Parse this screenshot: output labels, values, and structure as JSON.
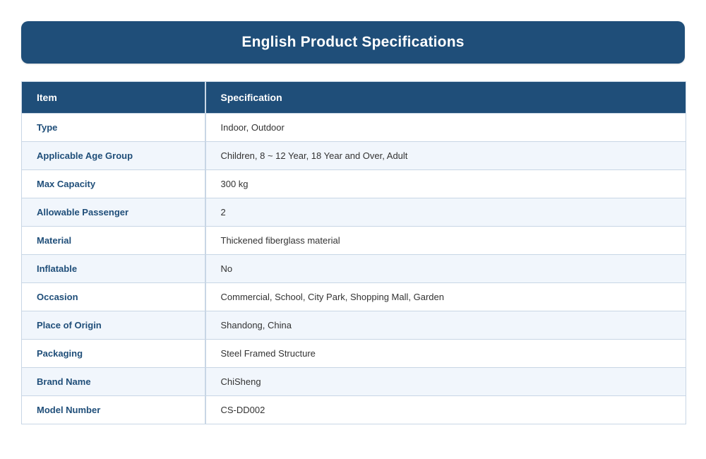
{
  "header": {
    "title": "English Product Specifications"
  },
  "table": {
    "columns": [
      "Item",
      "Specification"
    ],
    "rows": [
      {
        "item": "Type",
        "value": "Indoor, Outdoor"
      },
      {
        "item": "Applicable Age Group",
        "value": "Children, 8 ~ 12 Year, 18 Year and Over, Adult"
      },
      {
        "item": "Max Capacity",
        "value": "300 kg"
      },
      {
        "item": "Allowable Passenger",
        "value": "2"
      },
      {
        "item": "Material",
        "value": "Thickened fiberglass material"
      },
      {
        "item": "Inflatable",
        "value": "No"
      },
      {
        "item": "Occasion",
        "value": "Commercial, School, City Park, Shopping Mall, Garden"
      },
      {
        "item": "Place of Origin",
        "value": "Shandong, China"
      },
      {
        "item": "Packaging",
        "value": "Steel Framed Structure"
      },
      {
        "item": "Brand Name",
        "value": "ChiSheng"
      },
      {
        "item": "Model Number",
        "value": "CS-DD002"
      }
    ]
  },
  "colors": {
    "header_bg": "#1f4e79",
    "header_text": "#ffffff",
    "item_text": "#1f4e79",
    "value_text": "#333333",
    "stripe": "#f1f6fc",
    "border": "#c8d6e5"
  }
}
